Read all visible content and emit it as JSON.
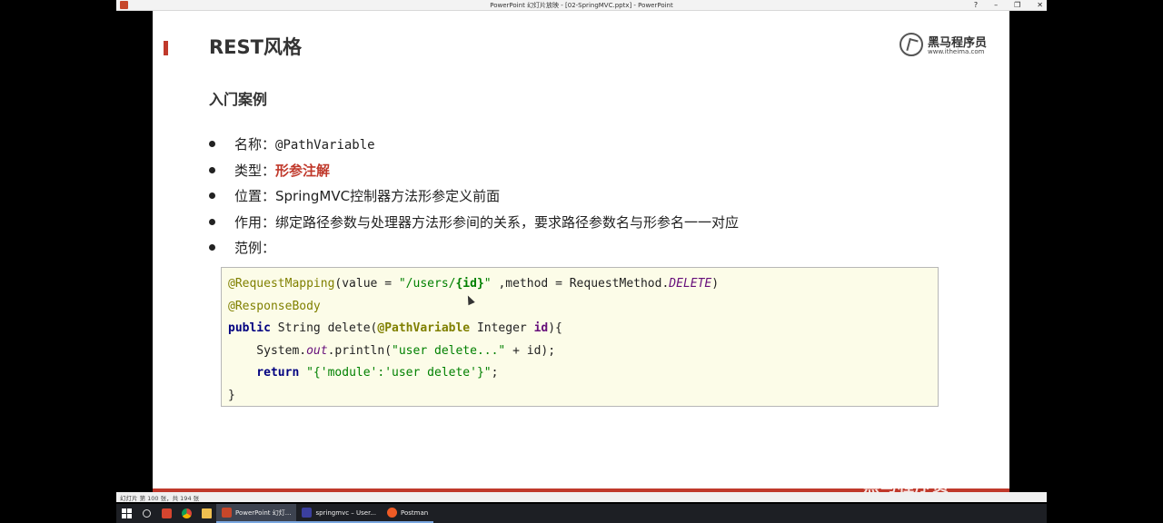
{
  "window": {
    "title": "PowerPoint 幻灯片放映 - [02-SpringMVC.pptx] - PowerPoint",
    "controls": [
      "?",
      "–",
      "❐",
      "✕"
    ]
  },
  "slide": {
    "title": "REST风格",
    "subtitle": "入门案例",
    "logo": {
      "brand": "黑马程序员",
      "site": "www.itheima.com"
    },
    "bullets": [
      {
        "label": "名称：",
        "value": "@PathVariable"
      },
      {
        "label": "类型：",
        "value": "形参注解"
      },
      {
        "label": "位置：",
        "value": "SpringMVC控制器方法形参定义前面"
      },
      {
        "label": "作用：",
        "value": "绑定路径参数与处理器方法形参间的关系，要求路径参数名与形参名一一对应"
      },
      {
        "label": "范例：",
        "value": ""
      }
    ],
    "code": {
      "l1_ann": "@RequestMapping",
      "l1_a": "(value = ",
      "l1_s1": "\"/users/",
      "l1_s2": "{id}",
      "l1_s3": "\"",
      "l1_b": " ,method = RequestMethod.",
      "l1_c": "DELETE",
      "l1_d": ")",
      "l2_ann": "@ResponseBody",
      "l3_kw": "public",
      "l3_a": " String delete(",
      "l3_ann": "@PathVariable",
      "l3_b": " Integer ",
      "l3_c": "id",
      "l3_d": "){",
      "l4_a": "    System.",
      "l4_b": "out",
      "l4_c": ".println(",
      "l4_s": "\"user delete...\"",
      "l4_d": " + id);",
      "l5_kw": "    return",
      "l5_sp": " ",
      "l5_s": "\"{'module':'user delete'}\"",
      "l5_d": ";",
      "l6": "}"
    }
  },
  "status_bar": {
    "text": "幻灯片 第 100 张，共 194 张"
  },
  "watermark": "黑马程序员",
  "taskbar": {
    "tasks": [
      {
        "label": "PowerPoint 幻灯...",
        "color": "#c7472a"
      },
      {
        "label": "springmvc – User...",
        "color": "#3b3f9e"
      },
      {
        "label": "Postman",
        "color": "#ef5b25"
      }
    ]
  }
}
